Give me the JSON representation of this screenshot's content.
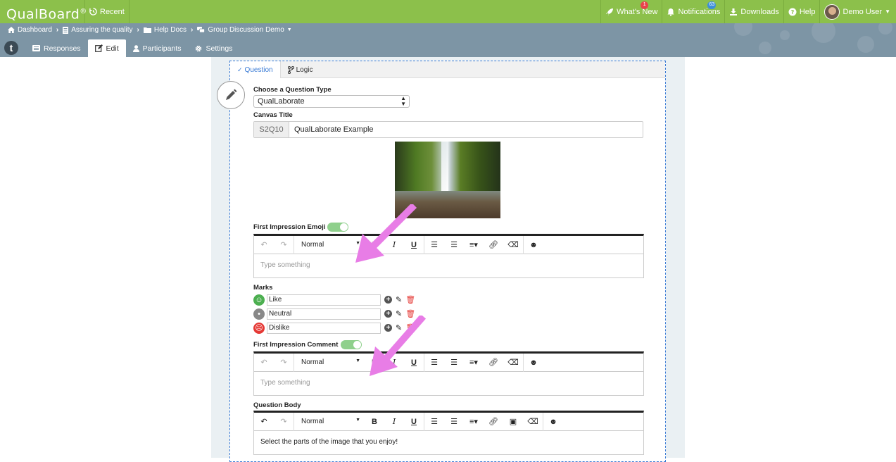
{
  "topbar": {
    "brand": "QualBoard",
    "brand_mark": "®",
    "recent_label": "Recent",
    "whats_new_label": "What's New",
    "whats_new_badge": "1",
    "notifications_label": "Notifications",
    "notifications_badge": "63",
    "downloads_label": "Downloads",
    "help_label": "Help",
    "user_label": "Demo User"
  },
  "breadcrumb": {
    "items": [
      "Dashboard",
      "Assuring the quality",
      "Help Docs",
      "Group Discussion Demo"
    ]
  },
  "nav_tabs": {
    "logo": "t",
    "responses": "Responses",
    "edit": "Edit",
    "participants": "Participants",
    "settings": "Settings"
  },
  "question_tabs": {
    "question": "Question",
    "logic": "Logic"
  },
  "form": {
    "question_type_label": "Choose a Question Type",
    "question_type_value": "QualLaborate",
    "canvas_title_label": "Canvas Title",
    "canvas_title_prefix": "S2Q10",
    "canvas_title_value": "QualLaborate Example",
    "first_impression_emoji_label": "First Impression Emoji",
    "marks_label": "Marks",
    "marks": [
      {
        "label": "Like"
      },
      {
        "label": "Neutral"
      },
      {
        "label": "Dislike"
      }
    ],
    "first_impression_comment_label": "First Impression Comment",
    "question_body_label": "Question Body",
    "editor_placeholder": "Type something",
    "editor_format": "Normal",
    "question_body_text": "Select the parts of the image that you enjoy!"
  },
  "colors": {
    "topbar": "#8cc04b",
    "subbar": "#7d95a5",
    "accent": "#3a7bd5",
    "annotation_arrow": "#e87de6"
  }
}
